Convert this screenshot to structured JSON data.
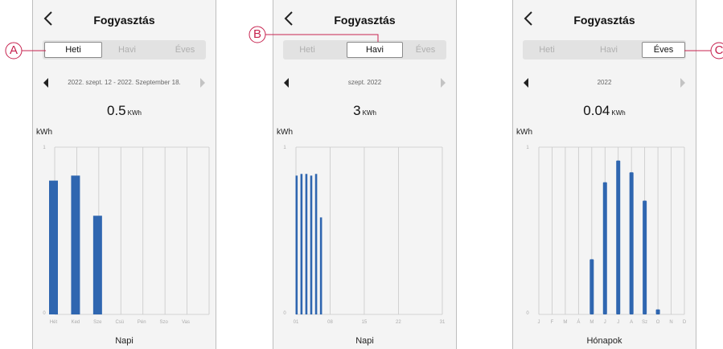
{
  "panels": [
    {
      "title": "Fogyasztás",
      "tabs": [
        "Heti",
        "Havi",
        "Éves"
      ],
      "active_tab": 0,
      "period": "2022. szept. 12 - 2022. Szeptember 18.",
      "total": {
        "value": "0.5",
        "unit": "KWh"
      },
      "callout": "A"
    },
    {
      "title": "Fogyasztás",
      "tabs": [
        "Heti",
        "Havi",
        "Éves"
      ],
      "active_tab": 1,
      "period": "szept. 2022",
      "total": {
        "value": "3",
        "unit": "KWh"
      },
      "callout": "B"
    },
    {
      "title": "Fogyasztás",
      "tabs": [
        "Heti",
        "Havi",
        "Éves"
      ],
      "active_tab": 2,
      "period": "2022",
      "total": {
        "value": "0.04",
        "unit": "KWh"
      },
      "callout": "C"
    }
  ],
  "colors": {
    "bar": "#2f66b0",
    "callout": "#c7234f",
    "grid": "#c8c8c8"
  },
  "icons": {
    "back": "chevron-left-icon",
    "prev": "triangle-left-icon",
    "next": "triangle-right-icon"
  },
  "chart_data": [
    {
      "type": "bar",
      "ylabel": "kWh",
      "xlabel": "Napi",
      "ylim": [
        0,
        1
      ],
      "y_ticks": [
        0,
        1
      ],
      "categories": [
        "Hét",
        "Ked",
        "Sze",
        "Csü",
        "Pén",
        "Szo",
        "Vas"
      ],
      "values": [
        0.8,
        0.83,
        0.59,
        0,
        0,
        0,
        0
      ]
    },
    {
      "type": "bar",
      "ylabel": "kWh",
      "xlabel": "Napi",
      "ylim": [
        0,
        1
      ],
      "y_ticks": [
        0,
        1
      ],
      "x_ticks": [
        "01",
        "08",
        "15",
        "22",
        "31"
      ],
      "x": [
        1,
        2,
        3,
        4,
        5,
        6
      ],
      "values": [
        0.83,
        0.84,
        0.84,
        0.83,
        0.84,
        0.58
      ]
    },
    {
      "type": "bar",
      "ylabel": "kWh",
      "xlabel": "Hónapok",
      "ylim": [
        0,
        1
      ],
      "y_ticks": [
        0,
        1
      ],
      "categories": [
        "J",
        "F",
        "M",
        "Á",
        "M",
        "J",
        "J",
        "A",
        "Sz",
        "O",
        "N",
        "D"
      ],
      "values": [
        0,
        0,
        0,
        0,
        0.33,
        0.79,
        0.92,
        0.85,
        0.68,
        0.03,
        0,
        0
      ]
    }
  ]
}
